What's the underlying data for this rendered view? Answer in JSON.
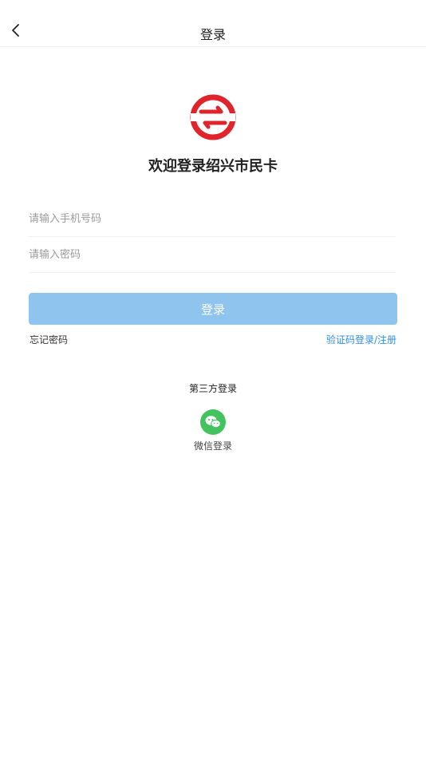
{
  "header": {
    "title": "登录"
  },
  "brand": {
    "welcome_text": "欢迎登录绍兴市民卡",
    "logo_color": "#e0242b"
  },
  "form": {
    "phone_placeholder": "请输入手机号码",
    "password_placeholder": "请输入密码",
    "login_label": "登录",
    "forgot_label": "忘记密码",
    "sms_login_label": "验证码登录/注册"
  },
  "third_party": {
    "title": "第三方登录",
    "wechat_label": "微信登录",
    "wechat_icon": "wechat-icon",
    "wechat_color": "#43c35e"
  },
  "colors": {
    "accent": "#2f8ee5",
    "button_disabled": "#8fc4ef"
  }
}
